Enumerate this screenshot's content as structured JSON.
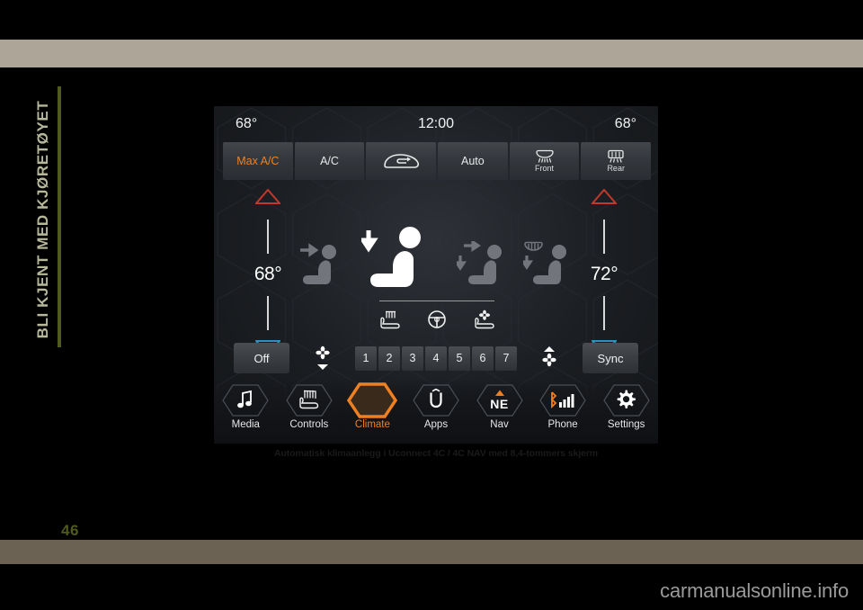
{
  "page": {
    "chapter_title": "BLI KJENT MED KJØRETØYET",
    "page_number": "46",
    "watermark": "carmanualsonline.info",
    "figure_caption": "Automatisk klimaanlegg i Uconnect 4C / 4C NAV med 8,4-tommers skjerm"
  },
  "colors": {
    "accent": "#ef8022",
    "hot": "#c0392b",
    "cold": "#2f8fbf",
    "bar_top": "#ada597",
    "bar_bottom": "#6b6253",
    "chapter": "#b7b79a",
    "rule": "#4f5a1c"
  },
  "screen": {
    "status": {
      "temp_left": "68°",
      "clock": "12:00",
      "temp_right": "68°"
    },
    "top_buttons": [
      {
        "label": "Max A/C",
        "active": true,
        "icon": ""
      },
      {
        "label": "A/C",
        "active": false,
        "icon": ""
      },
      {
        "label": "",
        "active": false,
        "icon": "recirculation-icon"
      },
      {
        "label": "Auto",
        "active": false,
        "icon": ""
      },
      {
        "label": "Front",
        "active": false,
        "icon": "front-defrost-icon"
      },
      {
        "label": "Rear",
        "active": false,
        "icon": "rear-defrost-icon"
      }
    ],
    "temp_left": {
      "value": "68°",
      "up_icon": "temp-up-triangle-icon",
      "down_icon": "temp-down-triangle-icon"
    },
    "temp_right": {
      "value": "72°",
      "up_icon": "temp-up-triangle-icon",
      "down_icon": "temp-down-triangle-icon"
    },
    "airflow_modes": [
      {
        "name": "airflow-face-icon",
        "active": false
      },
      {
        "name": "airflow-face-feet-icon",
        "active": true
      },
      {
        "name": "airflow-feet-icon",
        "active": false
      },
      {
        "name": "airflow-defrost-feet-icon",
        "active": false
      }
    ],
    "aux_icons": [
      {
        "name": "heated-seat-icon"
      },
      {
        "name": "heated-steering-wheel-icon"
      },
      {
        "name": "ventilated-seat-icon"
      }
    ],
    "controls": {
      "off_label": "Off",
      "sync_label": "Sync",
      "fan_down_icon": "fan-decrease-icon",
      "fan_up_icon": "fan-increase-icon",
      "fan_steps": [
        "1",
        "2",
        "3",
        "4",
        "5",
        "6",
        "7"
      ]
    },
    "nav": [
      {
        "label": "Media",
        "icon": "music-note-icon",
        "active": false
      },
      {
        "label": "Controls",
        "icon": "controls-icon",
        "active": false
      },
      {
        "label": "Climate",
        "icon": "climate-icon",
        "active": true
      },
      {
        "label": "Apps",
        "icon": "apps-icon",
        "active": false
      },
      {
        "label": "Nav",
        "icon": "compass-ne-icon",
        "active": false,
        "sub": "NE"
      },
      {
        "label": "Phone",
        "icon": "phone-signal-icon",
        "active": false
      },
      {
        "label": "Settings",
        "icon": "gear-icon",
        "active": false
      }
    ]
  }
}
